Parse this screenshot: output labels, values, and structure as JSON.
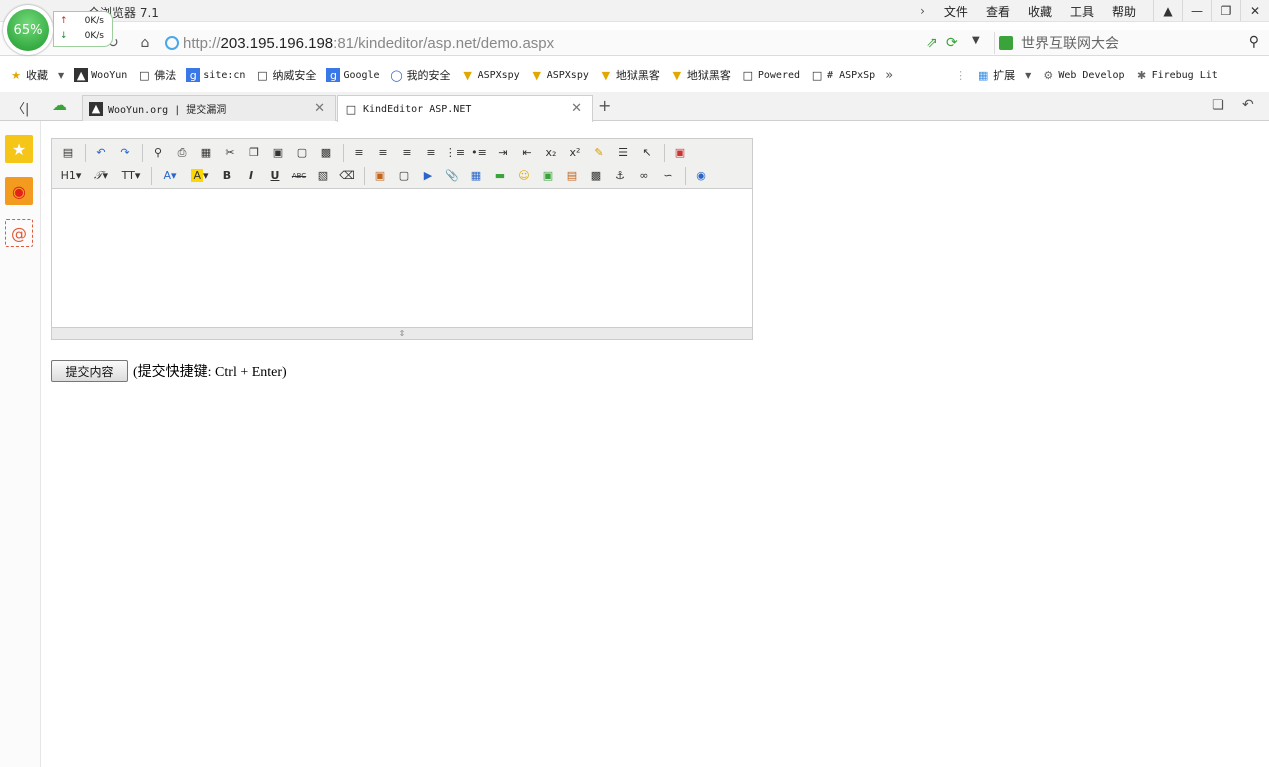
{
  "window": {
    "app_title": "全浏览器 7.1",
    "menus": [
      "文件",
      "查看",
      "收藏",
      "工具",
      "帮助"
    ]
  },
  "speed_widget": {
    "percent": "65%",
    "up": "0K/s",
    "down": "0K/s"
  },
  "address": {
    "scheme": "http://",
    "host": "203.195.196.198",
    "path": ":81/kindeditor/asp.net/demo.aspx",
    "search_placeholder": "世界互联网大会"
  },
  "favorites": {
    "favorites_label": "收藏",
    "items": [
      "WooYun",
      "佛法",
      "site:cn",
      "纳威安全",
      "Google",
      "我的安全",
      "ASPXspy",
      "ASPXspy",
      "地狱黑客",
      "地狱黑客",
      "Powered",
      "# ASPxSp"
    ],
    "extensions_label": "扩展",
    "web_develop": "Web Develop",
    "firebug": "Firebug Lit"
  },
  "tabs": [
    {
      "title": "WooYun.org | 提交漏洞"
    },
    {
      "title": "KindEditor ASP.NET"
    }
  ],
  "editor": {
    "toolbar_row1_icons": [
      "source-icon",
      "undo-icon",
      "redo-icon",
      "preview-icon",
      "print-icon",
      "template-icon",
      "cut-icon",
      "copy-icon",
      "paste-icon",
      "paste-plain-icon",
      "paste-word-icon",
      "align-left-icon",
      "align-center-icon",
      "align-right-icon",
      "align-justify-icon",
      "ordered-list-icon",
      "unordered-list-icon",
      "indent-icon",
      "outdent-icon",
      "subscript-icon",
      "superscript-icon",
      "clear-format-icon",
      "quick-format-icon",
      "select-all-icon",
      "fullscreen-icon"
    ],
    "toolbar_row2_icons": [
      "heading-icon",
      "font-family-icon",
      "font-size-icon",
      "font-color-icon",
      "highlight-icon",
      "bold-icon",
      "italic-icon",
      "underline-icon",
      "strikethrough-icon",
      "line-height-icon",
      "remove-format-icon",
      "image-icon",
      "multi-image-icon",
      "flash-icon",
      "media-icon",
      "attachment-icon",
      "table-icon",
      "horizontal-rule-icon",
      "emoticon-icon",
      "baidu-map-icon",
      "code-icon",
      "page-break-icon",
      "anchor-icon",
      "link-icon",
      "unlink-icon",
      "help-icon"
    ],
    "labels": {
      "bold": "B",
      "italic": "I",
      "underline": "U",
      "strike": "ABC",
      "heading": "H1",
      "font_size": "TT",
      "subscript": "x₂",
      "superscript": "x²"
    }
  },
  "form": {
    "submit_label": "提交内容",
    "hint": "(提交快捷键: Ctrl + Enter)"
  }
}
